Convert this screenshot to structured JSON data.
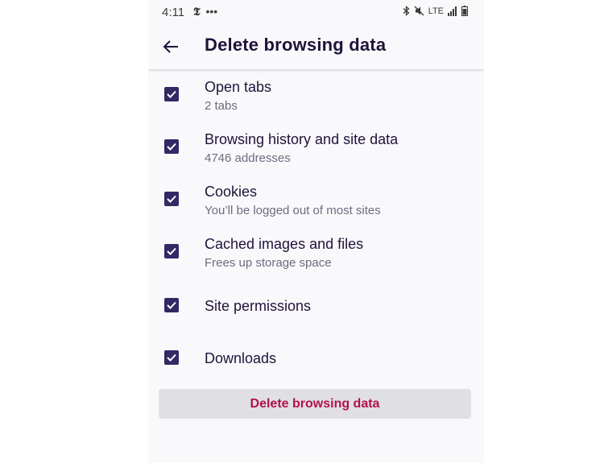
{
  "status_bar": {
    "time": "4:11",
    "left_icons": [
      "nyt-icon",
      "more-dots-icon"
    ],
    "network": "LTE",
    "right_icons": [
      "bluetooth-icon",
      "mute-icon",
      "lte-icon",
      "signal-icon",
      "battery-icon"
    ]
  },
  "toolbar": {
    "title": "Delete browsing data",
    "back_icon": "arrow-left-icon"
  },
  "items": [
    {
      "title": "Open tabs",
      "subtitle": "2 tabs",
      "checked": true
    },
    {
      "title": "Browsing history and site data",
      "subtitle": "4746 addresses",
      "checked": true
    },
    {
      "title": "Cookies",
      "subtitle": "You’ll be logged out of most sites",
      "checked": true
    },
    {
      "title": "Cached images and files",
      "subtitle": "Frees up storage space",
      "checked": true
    },
    {
      "title": "Site permissions",
      "subtitle": "",
      "checked": true
    },
    {
      "title": "Downloads",
      "subtitle": "",
      "checked": true
    }
  ],
  "delete_button": {
    "label": "Delete browsing data"
  },
  "colors": {
    "checkbox": "#312a65",
    "title_text": "#20123a",
    "subtitle_text": "#6f6a80",
    "button_bg": "#e0dfe4",
    "button_text": "#b1114d",
    "background": "#f9f9fb"
  }
}
